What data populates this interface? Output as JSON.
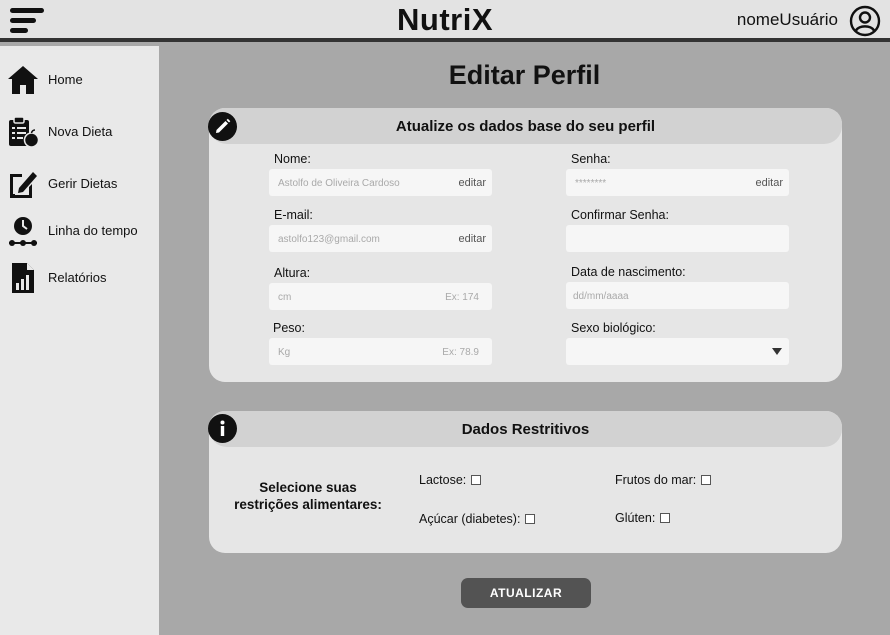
{
  "header": {
    "brand": "NutriX",
    "username": "nomeUsuário",
    "menu_icon": "hamburger-menu-icon",
    "user_icon": "user-circle-icon"
  },
  "sidebar": {
    "items": [
      {
        "label": "Home",
        "icon": "home-icon"
      },
      {
        "label": "Nova Dieta",
        "icon": "clipboard-apple-icon"
      },
      {
        "label": "Gerir Dietas",
        "icon": "edit-document-icon"
      },
      {
        "label": "Linha do tempo",
        "icon": "timeline-clock-icon"
      },
      {
        "label": "Relatórios",
        "icon": "report-chart-icon"
      }
    ]
  },
  "page": {
    "title": "Editar Perfil"
  },
  "profile_card": {
    "title": "Atualize os dados base do seu perfil",
    "icon": "pencil-icon",
    "fields": {
      "nome": {
        "label": "Nome:",
        "value": "Astolfo de Oliveira Cardoso",
        "action": "editar"
      },
      "email": {
        "label": "E-mail:",
        "value": "astolfo123@gmail.com",
        "action": "editar"
      },
      "altura": {
        "label": "Altura:",
        "placeholder": "cm",
        "hint": "Ex: 174"
      },
      "peso": {
        "label": "Peso:",
        "placeholder": "Kg",
        "hint": "Ex: 78.9"
      },
      "senha": {
        "label": "Senha:",
        "value": "********",
        "action": "editar"
      },
      "confirmar_senha": {
        "label": "Confirmar Senha:",
        "value": ""
      },
      "nascimento": {
        "label": "Data de nascimento:",
        "placeholder": "dd/mm/aaaa"
      },
      "sexo": {
        "label": "Sexo biológico:",
        "value": ""
      }
    }
  },
  "restrictions_card": {
    "title": "Dados Restritivos",
    "icon": "info-icon",
    "prompt_line1": "Selecione suas",
    "prompt_line2": "restrições alimentares:",
    "options": [
      {
        "label": "Lactose:",
        "checked": false
      },
      {
        "label": "Frutos do mar:",
        "checked": false
      },
      {
        "label": "Açúcar (diabetes):",
        "checked": false
      },
      {
        "label": "Glúten:",
        "checked": false
      }
    ]
  },
  "actions": {
    "update_label": "ATUALIZAR"
  },
  "colors": {
    "background": "#a8a8a8",
    "sidebar": "#e9e9e9",
    "card": "#e6e6e6",
    "card_header": "#d2d2d2",
    "button": "#535353"
  }
}
